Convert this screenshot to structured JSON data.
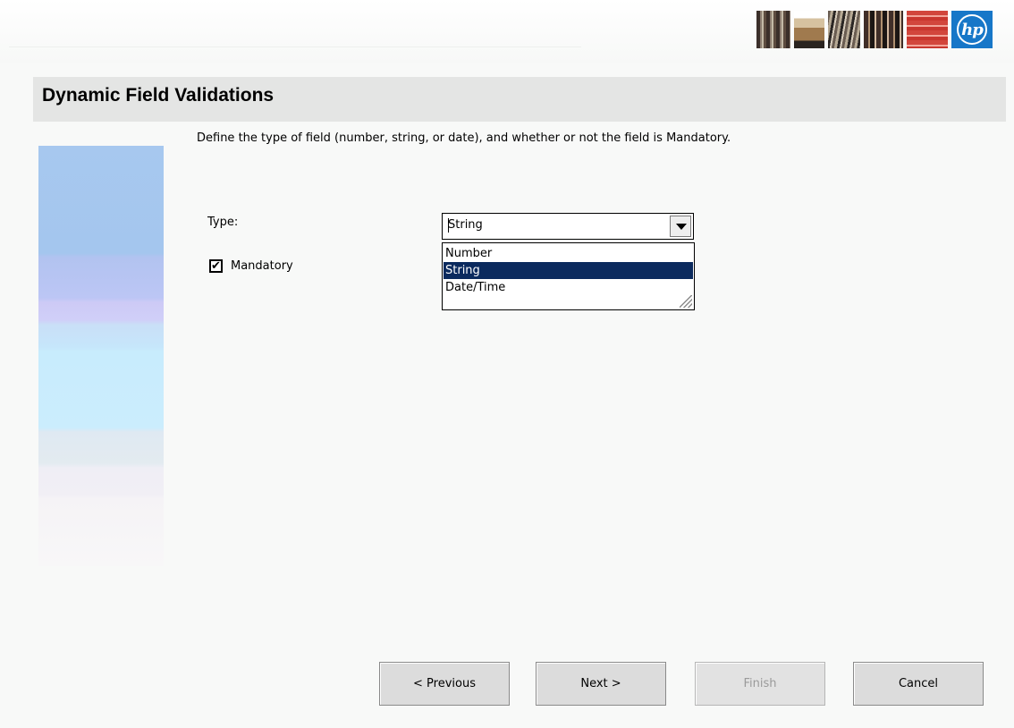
{
  "page": {
    "title": "Dynamic Field Validations"
  },
  "instructions": "Define the type of field (number, string, or date), and whether or not the field is Mandatory.",
  "type_field": {
    "label": "Type:",
    "value": "String",
    "options": [
      "Number",
      "String",
      "Date/Time"
    ],
    "highlighted_option": "String",
    "expanded": true
  },
  "mandatory": {
    "label": "Mandatory",
    "checked": true,
    "check_glyph": "✔"
  },
  "buttons": {
    "previous": "< Previous",
    "next": "Next >",
    "finish": "Finish",
    "cancel": "Cancel"
  },
  "branding": {
    "logo_text": "hp",
    "logo_color": "#1777c8"
  },
  "colors": {
    "selection": "#0b2a5e",
    "title_bar": "#e4e5e4",
    "disabled_text": "#9a9a9a"
  }
}
